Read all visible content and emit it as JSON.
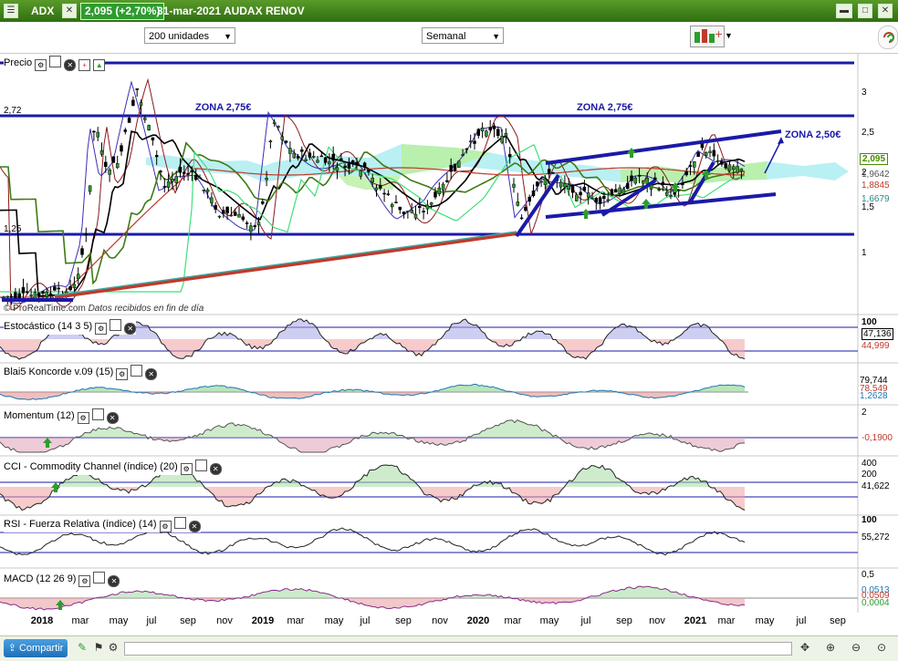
{
  "titlebar": {
    "ticker": "ADX",
    "price_change": "2,095 (+2,70%)",
    "date_name": "31-mar-2021 AUDAX RENOV"
  },
  "toolbar": {
    "units_select": "200 unidades",
    "period_select": "Semanal"
  },
  "price_panel": {
    "label": "Precio",
    "left_levels": [
      "2,72",
      "1,25"
    ],
    "axis_ticks": [
      "3",
      "2,5",
      "2",
      "1,5",
      "1"
    ],
    "value_tags": [
      {
        "text": "2,095",
        "color": "#4a8a00"
      },
      {
        "text": "1,9642",
        "color": "#777777"
      },
      {
        "text": "1,8845",
        "color": "#c0392b"
      },
      {
        "text": "1,6679",
        "color": "#3fa7a0"
      }
    ],
    "annotations": [
      "ZONA 2,75€",
      "ZONA 2,75€",
      "ZONA 2,50€"
    ],
    "source": "© ProRealTime.com",
    "source_note": "Datos recibidos en fin de día"
  },
  "indicator_panels": [
    {
      "label": "Estocástico (14 3 5)",
      "axis_top": "100",
      "values": [
        "47,136",
        "44,999"
      ],
      "colors": [
        "#000000",
        "#c0392b"
      ]
    },
    {
      "label": "Blai5 Koncorde v.09 (15)",
      "axis_top": "",
      "values": [
        "79,744",
        "78,549",
        "1,2628"
      ],
      "colors": [
        "#000000",
        "#c0392b",
        "#1f77b4"
      ]
    },
    {
      "label": "Momentum (12)",
      "axis_top": "2",
      "values": [
        "-0,1900"
      ],
      "colors": [
        "#c0392b"
      ]
    },
    {
      "label": "CCI - Commodity Channel (índice) (20)",
      "axis_top": "400",
      "axis_second": "200",
      "values": [
        "41,622"
      ],
      "colors": [
        "#000000"
      ]
    },
    {
      "label": "RSI - Fuerza Relativa (índice) (14)",
      "axis_top": "100",
      "values": [
        "55,272"
      ],
      "colors": [
        "#000000"
      ]
    },
    {
      "label": "MACD (12 26 9)",
      "axis_top": "0,5",
      "values": [
        "0,0513",
        "0,0509",
        "0,0004"
      ],
      "colors": [
        "#1f77b4",
        "#c0392b",
        "#2e9c2e"
      ]
    }
  ],
  "time_axis": [
    "2018",
    "mar",
    "may",
    "jul",
    "sep",
    "nov",
    "2019",
    "mar",
    "may",
    "jul",
    "sep",
    "nov",
    "2020",
    "mar",
    "may",
    "jul",
    "sep",
    "nov",
    "2021",
    "mar",
    "may",
    "jul",
    "sep"
  ],
  "bottombar": {
    "share_label": "Compartir"
  },
  "colors": {
    "accent_green": "#3d7f1a",
    "line_blue": "#1a1aa8",
    "support_red": "#c0392b"
  }
}
